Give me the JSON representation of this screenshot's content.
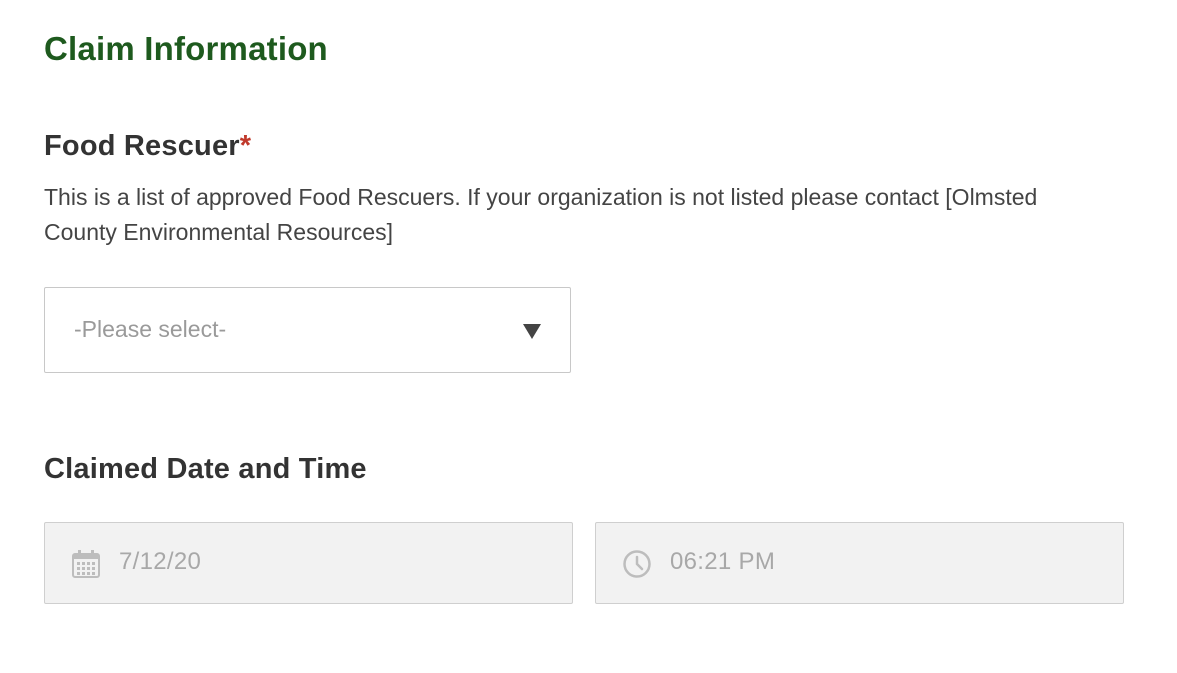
{
  "section": {
    "title": "Claim Information"
  },
  "food_rescuer": {
    "label": "Food Rescuer",
    "required_marker": "*",
    "help_text": "This is a list of approved Food Rescuers. If your organization is not listed please contact [Olmsted County Environmental Resources]",
    "select": {
      "selected_value": "-Please select-",
      "arrow_icon": "triangle-down-icon"
    }
  },
  "claimed_datetime": {
    "label": "Claimed Date and Time",
    "date": {
      "value": "7/12/20",
      "icon": "calendar-icon"
    },
    "time": {
      "value": "06:21 PM",
      "icon": "clock-icon"
    }
  },
  "colors": {
    "title": "#1e5a1e",
    "required": "#c0392b",
    "label": "#333333",
    "readonly_bg": "#f2f2f2"
  }
}
